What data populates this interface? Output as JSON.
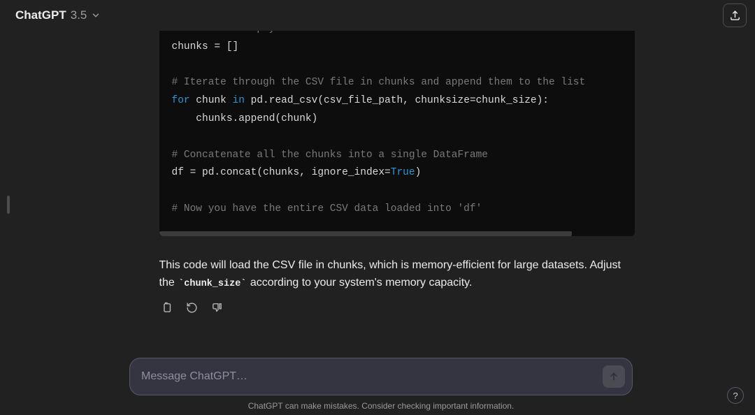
{
  "header": {
    "model_name": "ChatGPT",
    "model_version": "3.5"
  },
  "code": {
    "lines": [
      {
        "segs": [
          [
            "cm",
            "# Create an empty list to store the chunks"
          ]
        ]
      },
      {
        "segs": [
          [
            "tx",
            "chunks = []"
          ]
        ]
      },
      {
        "segs": [
          [
            "tx",
            ""
          ]
        ]
      },
      {
        "segs": [
          [
            "cm",
            "# Iterate through the CSV file in chunks and append them to the list"
          ]
        ]
      },
      {
        "segs": [
          [
            "kw",
            "for"
          ],
          [
            "tx",
            " chunk "
          ],
          [
            "kw",
            "in"
          ],
          [
            "tx",
            " pd.read_csv(csv_file_path, chunksize=chunk_size):"
          ]
        ]
      },
      {
        "segs": [
          [
            "tx",
            "    chunks.append(chunk)"
          ]
        ]
      },
      {
        "segs": [
          [
            "tx",
            ""
          ]
        ]
      },
      {
        "segs": [
          [
            "cm",
            "# Concatenate all the chunks into a single DataFrame"
          ]
        ]
      },
      {
        "segs": [
          [
            "tx",
            "df = pd.concat(chunks, ignore_index="
          ],
          [
            "bl",
            "True"
          ],
          [
            "tx",
            ")"
          ]
        ]
      },
      {
        "segs": [
          [
            "tx",
            ""
          ]
        ]
      },
      {
        "segs": [
          [
            "cm",
            "# Now you have the entire CSV data loaded into 'df'"
          ]
        ]
      }
    ]
  },
  "response": {
    "text_before": "This code will load the CSV file in chunks, which is memory-efficient for large datasets. Adjust the ",
    "inline_code": "chunk_size",
    "text_after": " according to your system's memory capacity."
  },
  "input": {
    "placeholder": "Message ChatGPT…"
  },
  "footer": {
    "disclaimer": "ChatGPT can make mistakes. Consider checking important information."
  },
  "help": {
    "label": "?"
  }
}
